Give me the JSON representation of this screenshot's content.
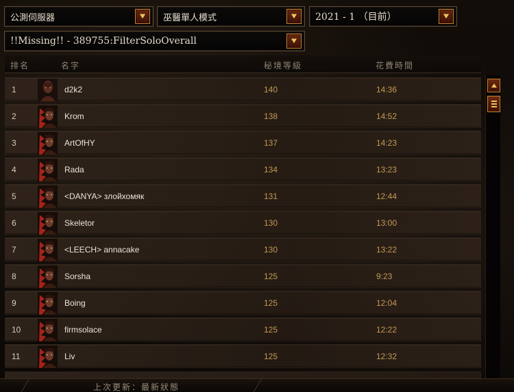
{
  "filters": {
    "server": "公測伺服器",
    "mode": "巫醫單人模式",
    "season": "2021 - 1 （目前）",
    "category": "!!Missing!! - 389755:FilterSoloOverall"
  },
  "columns": {
    "rank": "排名",
    "name": "名字",
    "level": "秘境等級",
    "time": "花費時間"
  },
  "rows": [
    {
      "rank": "1",
      "name": "d2k2",
      "level": "140",
      "time": "14:36",
      "portrait": "male"
    },
    {
      "rank": "2",
      "name": "Krom",
      "level": "138",
      "time": "14:52",
      "portrait": "female"
    },
    {
      "rank": "3",
      "name": "ArtOfHY",
      "level": "137",
      "time": "14:23",
      "portrait": "female"
    },
    {
      "rank": "4",
      "name": "Rada",
      "level": "134",
      "time": "13:23",
      "portrait": "female"
    },
    {
      "rank": "5",
      "name": "<DANYA> злойхомяк",
      "level": "131",
      "time": "12:44",
      "portrait": "female"
    },
    {
      "rank": "6",
      "name": "Skeletor",
      "level": "130",
      "time": "13:00",
      "portrait": "female"
    },
    {
      "rank": "7",
      "name": "<LEECH> annacake",
      "level": "130",
      "time": "13:22",
      "portrait": "female"
    },
    {
      "rank": "8",
      "name": "Sorsha",
      "level": "125",
      "time": "9:23",
      "portrait": "female"
    },
    {
      "rank": "9",
      "name": "Boing",
      "level": "125",
      "time": "12:04",
      "portrait": "female"
    },
    {
      "rank": "10",
      "name": "firmsolace",
      "level": "125",
      "time": "12:22",
      "portrait": "female"
    },
    {
      "rank": "11",
      "name": "Liv",
      "level": "125",
      "time": "12:32",
      "portrait": "female"
    }
  ],
  "status": "上次更新：最新狀態",
  "icons": {
    "dropdown": "chevron-down-icon",
    "scroll_up": "arrow-up-icon",
    "scroll_thumb": "scroll-thumb-icon"
  },
  "colors": {
    "accent": "#c8812f",
    "button": "#6b2a10",
    "value": "#c49a54"
  }
}
